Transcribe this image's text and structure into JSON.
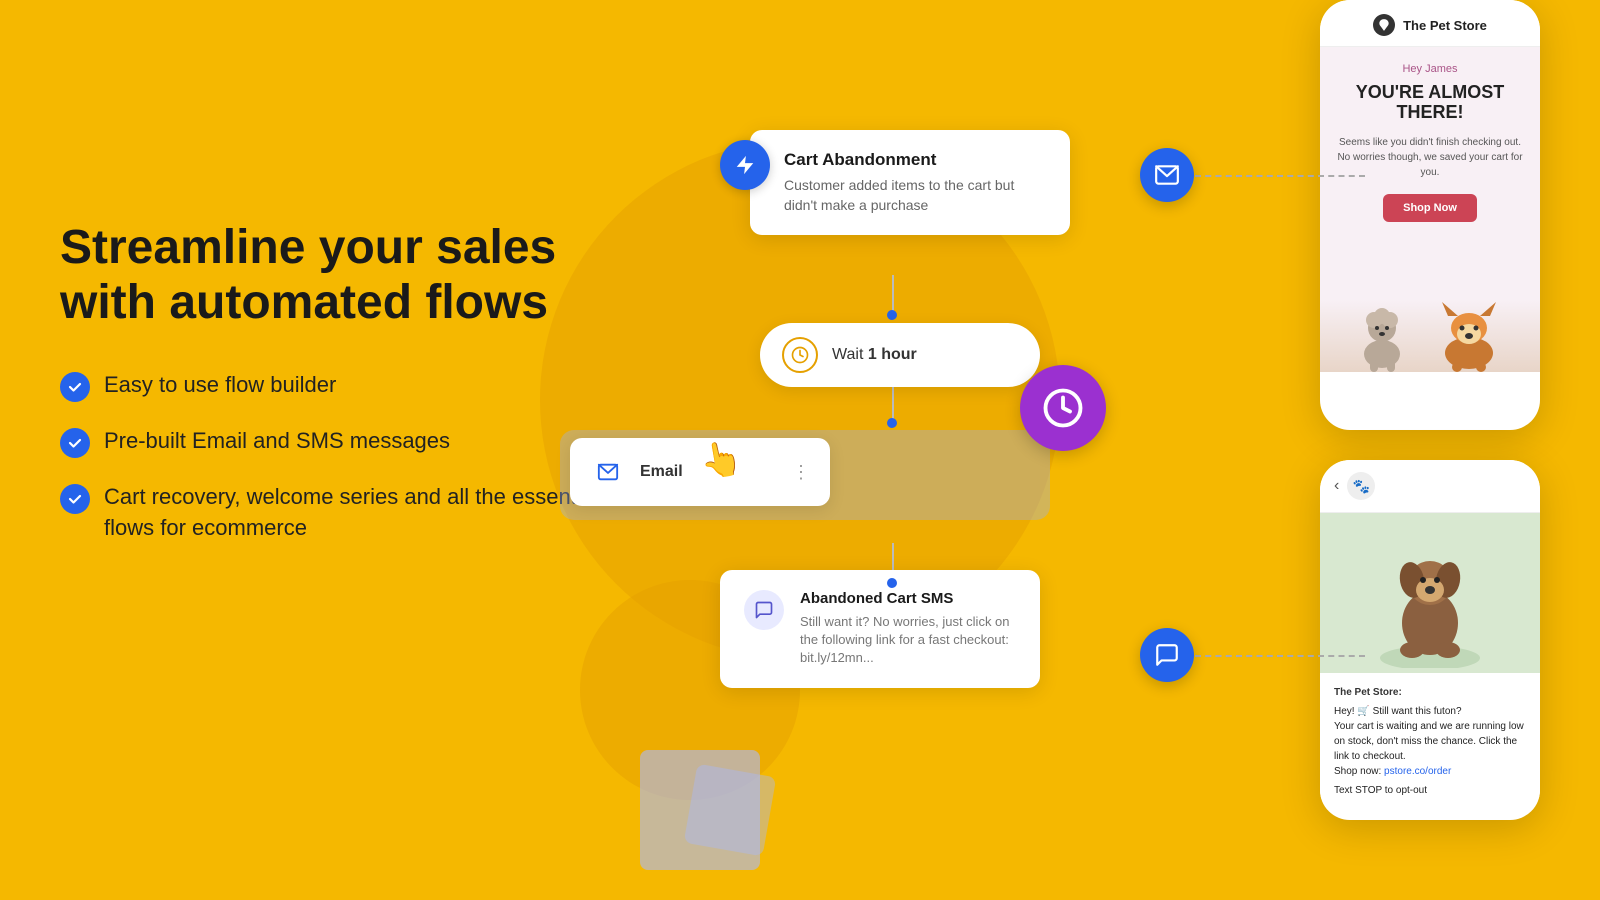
{
  "background": {
    "color": "#F5B800"
  },
  "headline": {
    "line1": "Streamline your sales",
    "line2": "with automated flows"
  },
  "features": [
    {
      "id": 1,
      "text": "Easy to use flow builder"
    },
    {
      "id": 2,
      "text": "Pre-built Email and SMS messages"
    },
    {
      "id": 3,
      "text": "Cart recovery, welcome series and all the essential flows for ecommerce"
    }
  ],
  "flow": {
    "trigger": {
      "title": "Cart Abandonment",
      "description": "Customer added items to the cart but didn't make a purchase"
    },
    "wait": {
      "label": "Wait ",
      "value": "1 hour"
    },
    "email": {
      "label": "Email"
    },
    "sms": {
      "title": "Abandoned Cart SMS",
      "description": "Still want it? No worries, just click on the following link for a fast checkout: bit.ly/12mn..."
    }
  },
  "phone_top": {
    "store_name": "The Pet Store",
    "greeting": "Hey James",
    "headline1": "YOU'RE ALMOST",
    "headline2": "THERE!",
    "body_text": "Seems like you didn't finish checking out. No worries though, we saved your cart for you.",
    "cta": "Shop Now"
  },
  "phone_bottom": {
    "sender": "The Pet Store:",
    "message_line1": "Hey! 🛒 Still want this futon?",
    "message_line2": "Your cart is waiting and we are running low on stock, don't miss the chance. Click the link to checkout.",
    "message_line3": "Shop now: pstore.co/order",
    "opt_out": "Text STOP to opt-out"
  }
}
